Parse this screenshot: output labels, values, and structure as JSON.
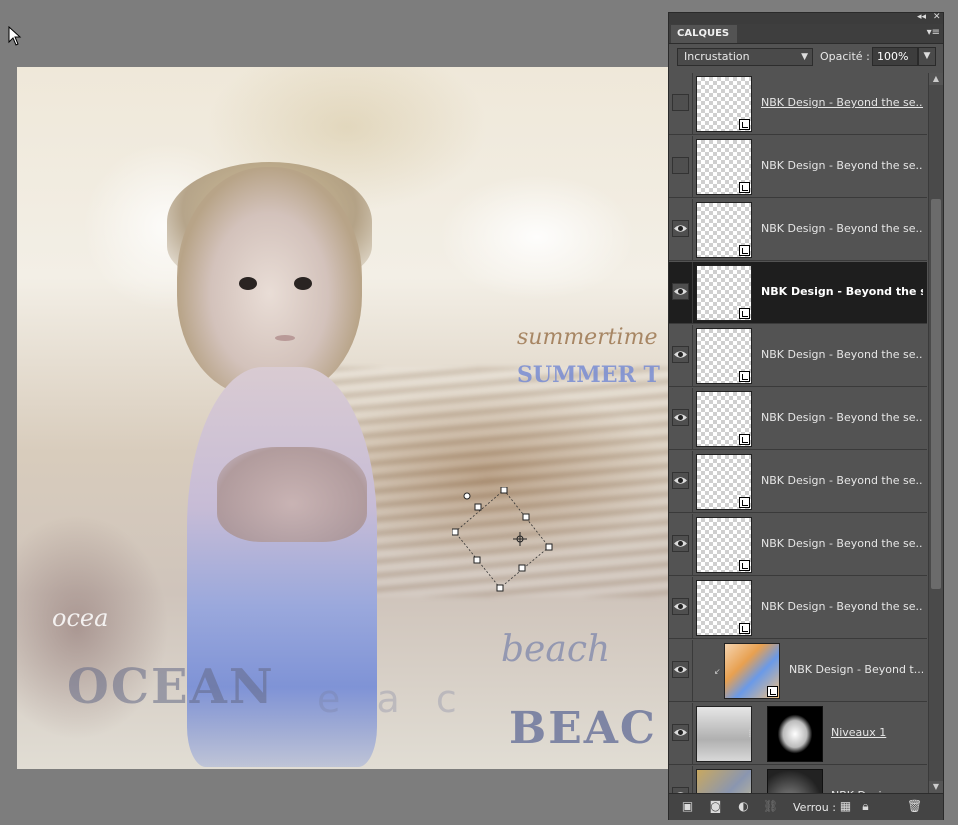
{
  "panel": {
    "tab_title": "CALQUES",
    "blend_mode": "Incrustation",
    "opacity_label": "Opacité :",
    "opacity_value": "100%",
    "lock_label": "Verrou :"
  },
  "layers": [
    {
      "name": "NBK Design - Beyond the se...",
      "visible": false,
      "underlined": true,
      "active": false
    },
    {
      "name": "NBK Design - Beyond the se...",
      "visible": false,
      "underlined": false,
      "active": false
    },
    {
      "name": "NBK Design - Beyond the se...",
      "visible": true,
      "underlined": false,
      "active": false
    },
    {
      "name": "NBK Design - Beyond the s...",
      "visible": true,
      "underlined": false,
      "active": true
    },
    {
      "name": "NBK Design - Beyond the se...",
      "visible": true,
      "underlined": false,
      "active": false
    },
    {
      "name": "NBK Design - Beyond the se...",
      "visible": true,
      "underlined": false,
      "active": false
    },
    {
      "name": "NBK Design - Beyond the se...",
      "visible": true,
      "underlined": false,
      "active": false
    },
    {
      "name": "NBK Design - Beyond the se...",
      "visible": true,
      "underlined": false,
      "active": false
    },
    {
      "name": "NBK Design - Beyond the se...",
      "visible": true,
      "underlined": false,
      "active": false
    },
    {
      "name": "NBK Design - Beyond t...",
      "visible": true,
      "underlined": false,
      "active": false
    },
    {
      "name": "Niveaux 1",
      "visible": true,
      "underlined": true,
      "active": false
    },
    {
      "name": "NBK Design",
      "visible": true,
      "underlined": false,
      "active": false
    }
  ],
  "artwork": {
    "ocean": "OCEAN",
    "beach": "BEAC",
    "summer": "SUMMER T",
    "script_summertime": "summertime",
    "script_beach": "beach",
    "script_ocean": "ocea",
    "faded_letters": "e a c"
  },
  "colors": {
    "workspace": "#7d7d7d",
    "panel": "#535353",
    "active_layer": "#1e1e1e"
  },
  "icons": {
    "cursor": "arrow-cursor-icon",
    "visibility": "eye-icon",
    "link": "chain-link-icon",
    "new_layer": "new-layer-icon",
    "mask": "layer-mask-icon",
    "adjustment": "adjustment-layer-icon",
    "lock_transparency": "lock-transparency-icon",
    "lock_all": "lock-icon",
    "delete": "trash-icon",
    "menu": "panel-menu-icon"
  }
}
